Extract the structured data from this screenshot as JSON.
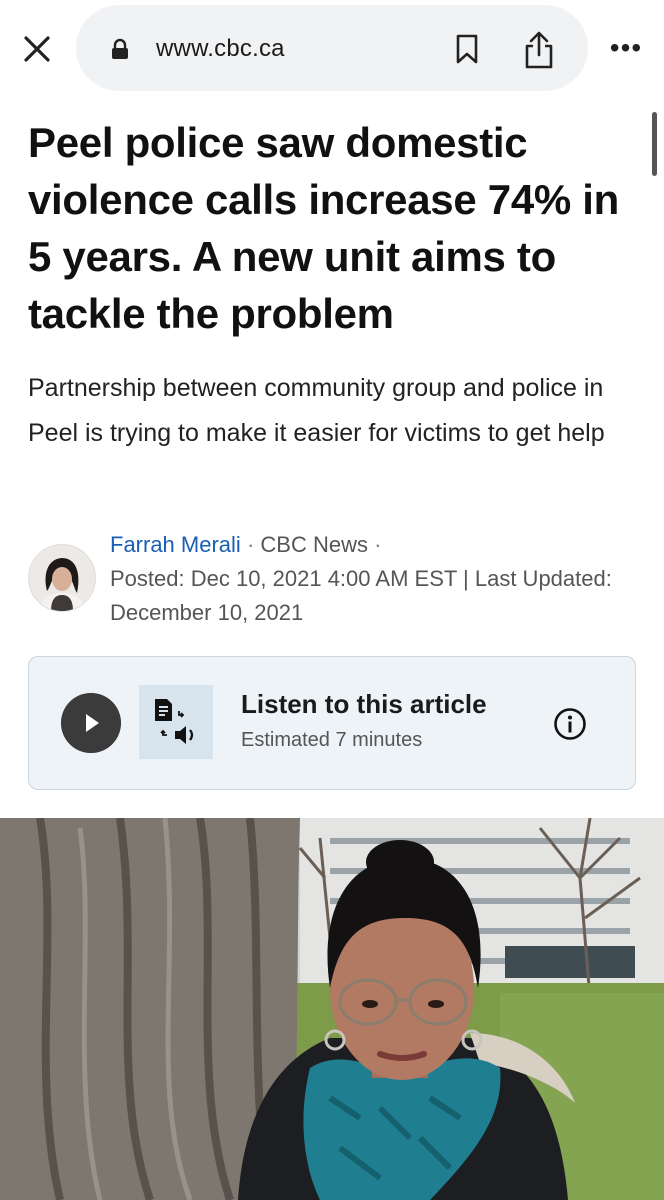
{
  "browser": {
    "url": "www.cbc.ca"
  },
  "article": {
    "headline": "Peel police saw domestic violence calls increase 74% in 5 years. A new unit aims to tackle the problem",
    "dek": "Partnership between community group and police in Peel is trying to make it easier for victims to get help",
    "author": "Farrah Merali",
    "outlet": "CBC News",
    "posted": "Posted: Dec 10, 2021 4:00 AM EST | Last Updated: December 10, 2021"
  },
  "listen": {
    "title": "Listen to this article",
    "subtitle": "Estimated 7 minutes"
  },
  "colors": {
    "link": "#1a5fb4",
    "card_bg": "#eef3f8",
    "play_bg": "#3b3b3b"
  }
}
